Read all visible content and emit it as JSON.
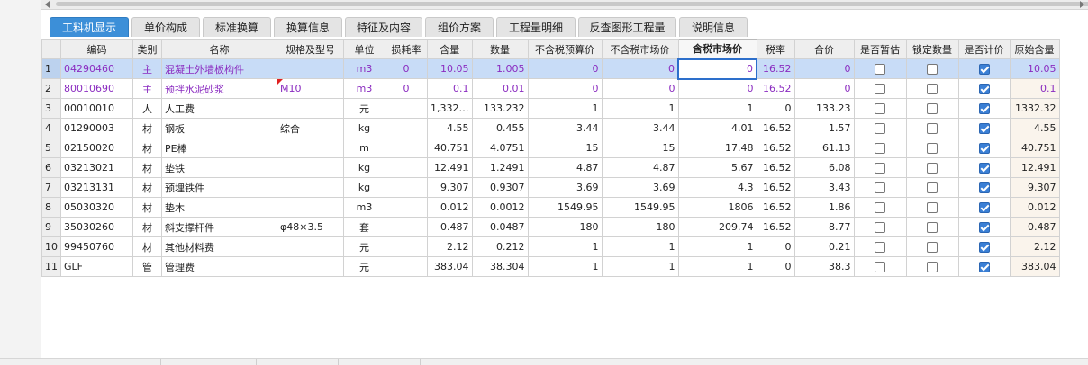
{
  "tabs": [
    {
      "label": "工料机显示",
      "active": true
    },
    {
      "label": "单价构成"
    },
    {
      "label": "标准换算"
    },
    {
      "label": "换算信息"
    },
    {
      "label": "特征及内容"
    },
    {
      "label": "组价方案"
    },
    {
      "label": "工程量明细"
    },
    {
      "label": "反查图形工程量"
    },
    {
      "label": "说明信息"
    }
  ],
  "columns": [
    "",
    "编码",
    "类别",
    "名称",
    "规格及型号",
    "单位",
    "损耗率",
    "含量",
    "数量",
    "不含税预算价",
    "不含税市场价",
    "含税市场价",
    "税率",
    "合价",
    "是否暂估",
    "锁定数量",
    "是否计价",
    "原始含量"
  ],
  "rows": [
    {
      "idx": "1",
      "code": "04290460",
      "type": "主",
      "name": "混凝土外墙板构件",
      "spec": "",
      "unit": "m3",
      "loss": "0",
      "content": "10.05",
      "qty": "1.005",
      "pre_budget": "0",
      "pre_market": "0",
      "tax_market": "0",
      "tax_rate": "16.52",
      "total": "0",
      "est": false,
      "lock": false,
      "priced": true,
      "orig": "10.05"
    },
    {
      "idx": "2",
      "code": "80010690",
      "type": "主",
      "name": "预拌水泥砂浆",
      "spec": "M10",
      "unit": "m3",
      "loss": "0",
      "content": "0.1",
      "qty": "0.01",
      "pre_budget": "0",
      "pre_market": "0",
      "tax_market": "0",
      "tax_rate": "16.52",
      "total": "0",
      "est": false,
      "lock": false,
      "priced": true,
      "orig": "0.1"
    },
    {
      "idx": "3",
      "code": "00010010",
      "type": "人",
      "name": "人工费",
      "spec": "",
      "unit": "元",
      "loss": "",
      "content": "1,332…",
      "qty": "133.232",
      "pre_budget": "1",
      "pre_market": "1",
      "tax_market": "1",
      "tax_rate": "0",
      "total": "133.23",
      "est": false,
      "lock": false,
      "priced": true,
      "orig": "1332.32"
    },
    {
      "idx": "4",
      "code": "01290003",
      "type": "材",
      "name": "钢板",
      "spec": "综合",
      "unit": "kg",
      "loss": "",
      "content": "4.55",
      "qty": "0.455",
      "pre_budget": "3.44",
      "pre_market": "3.44",
      "tax_market": "4.01",
      "tax_rate": "16.52",
      "total": "1.57",
      "est": false,
      "lock": false,
      "priced": true,
      "orig": "4.55"
    },
    {
      "idx": "5",
      "code": "02150020",
      "type": "材",
      "name": "PE棒",
      "spec": "",
      "unit": "m",
      "loss": "",
      "content": "40.751",
      "qty": "4.0751",
      "pre_budget": "15",
      "pre_market": "15",
      "tax_market": "17.48",
      "tax_rate": "16.52",
      "total": "61.13",
      "est": false,
      "lock": false,
      "priced": true,
      "orig": "40.751"
    },
    {
      "idx": "6",
      "code": "03213021",
      "type": "材",
      "name": "垫铁",
      "spec": "",
      "unit": "kg",
      "loss": "",
      "content": "12.491",
      "qty": "1.2491",
      "pre_budget": "4.87",
      "pre_market": "4.87",
      "tax_market": "5.67",
      "tax_rate": "16.52",
      "total": "6.08",
      "est": false,
      "lock": false,
      "priced": true,
      "orig": "12.491"
    },
    {
      "idx": "7",
      "code": "03213131",
      "type": "材",
      "name": "预埋铁件",
      "spec": "",
      "unit": "kg",
      "loss": "",
      "content": "9.307",
      "qty": "0.9307",
      "pre_budget": "3.69",
      "pre_market": "3.69",
      "tax_market": "4.3",
      "tax_rate": "16.52",
      "total": "3.43",
      "est": false,
      "lock": false,
      "priced": true,
      "orig": "9.307"
    },
    {
      "idx": "8",
      "code": "05030320",
      "type": "材",
      "name": "垫木",
      "spec": "",
      "unit": "m3",
      "loss": "",
      "content": "0.012",
      "qty": "0.0012",
      "pre_budget": "1549.95",
      "pre_market": "1549.95",
      "tax_market": "1806",
      "tax_rate": "16.52",
      "total": "1.86",
      "est": false,
      "lock": false,
      "priced": true,
      "orig": "0.012"
    },
    {
      "idx": "9",
      "code": "35030260",
      "type": "材",
      "name": "斜支撑杆件",
      "spec": "φ48×3.5",
      "unit": "套",
      "loss": "",
      "content": "0.487",
      "qty": "0.0487",
      "pre_budget": "180",
      "pre_market": "180",
      "tax_market": "209.74",
      "tax_rate": "16.52",
      "total": "8.77",
      "est": false,
      "lock": false,
      "priced": true,
      "orig": "0.487"
    },
    {
      "idx": "10",
      "code": "99450760",
      "type": "材",
      "name": "其他材料费",
      "spec": "",
      "unit": "元",
      "loss": "",
      "content": "2.12",
      "qty": "0.212",
      "pre_budget": "1",
      "pre_market": "1",
      "tax_market": "1",
      "tax_rate": "0",
      "total": "0.21",
      "est": false,
      "lock": false,
      "priced": true,
      "orig": "2.12"
    },
    {
      "idx": "11",
      "code": "GLF",
      "type": "管",
      "name": "管理费",
      "spec": "",
      "unit": "元",
      "loss": "",
      "content": "383.04",
      "qty": "38.304",
      "pre_budget": "1",
      "pre_market": "1",
      "tax_market": "1",
      "tax_rate": "0",
      "total": "38.3",
      "est": false,
      "lock": false,
      "priced": true,
      "orig": "383.04"
    }
  ],
  "colors": {
    "tab_active": "#3c8fd8",
    "main_text": "#8a2bc0",
    "selected_row": "#c8dcf7",
    "checkbox_on": "#3a7fd5"
  }
}
